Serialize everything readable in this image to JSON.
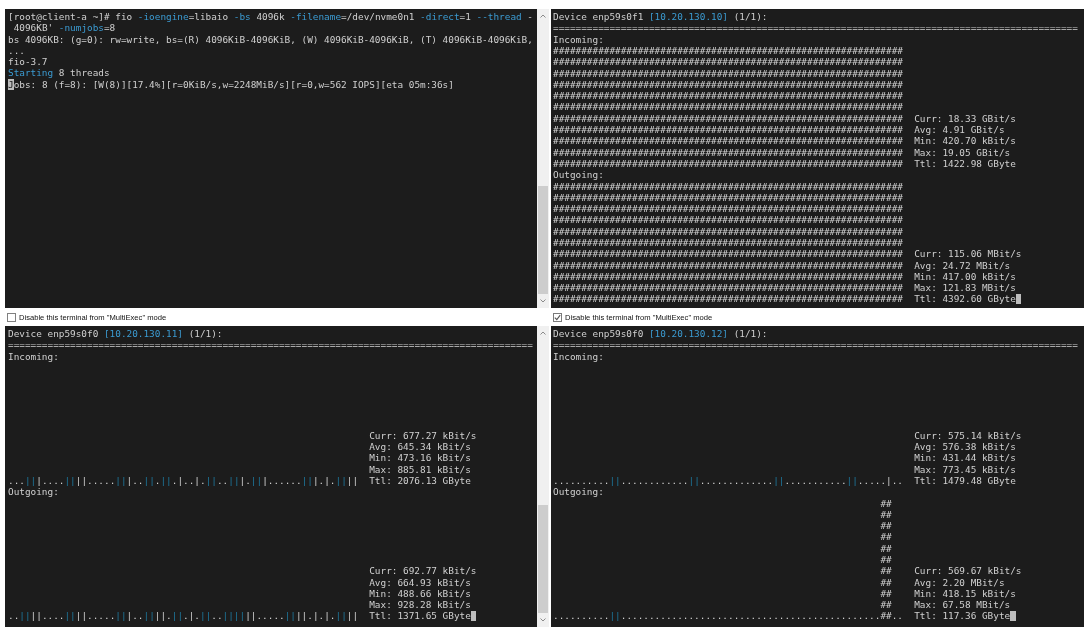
{
  "panes": [
    {
      "kind": "shell",
      "cursor": true,
      "scrollbar": true,
      "lines": [
        [
          {
            "text": "[root@client-a ~]# fio ",
            "kind": "plain"
          },
          {
            "text": "-ioengine",
            "kind": "accent"
          },
          {
            "text": "=libaio ",
            "kind": "plain"
          },
          {
            "text": "-bs",
            "kind": "accent"
          },
          {
            "text": " 4096k ",
            "kind": "plain"
          },
          {
            "text": "-filename",
            "kind": "accent"
          },
          {
            "text": "=/dev/nvme0n1 ",
            "kind": "plain"
          },
          {
            "text": "-direct",
            "kind": "accent"
          },
          {
            "text": "=1 ",
            "kind": "plain"
          },
          {
            "text": "--thread",
            "kind": "accent"
          },
          {
            "text": " -",
            "kind": "plain"
          }
        ],
        [
          {
            "text": " 4096KB' ",
            "kind": "plain"
          },
          {
            "text": "-numjobs",
            "kind": "accent"
          },
          {
            "text": "=8",
            "kind": "plain"
          }
        ],
        [
          {
            "text": "bs 4096KB: (g=0): rw=write, bs=(R) 4096KiB-4096KiB, (W) 4096KiB-4096KiB, (T) 4096KiB-4096KiB,",
            "kind": "plain"
          }
        ],
        [
          {
            "text": "...",
            "kind": "plain"
          }
        ],
        [
          {
            "text": "fio-3.7",
            "kind": "plain"
          }
        ],
        [
          {
            "text": "Starting",
            "kind": "accent"
          },
          {
            "text": " 8 threads",
            "kind": "plain"
          }
        ],
        [
          {
            "text": "Jobs: 8 (f=8): [W(8)][17.4%][r=0KiB/s,w=2248MiB/s][r=0,w=562 IOPS][eta 05m:36s]",
            "kind": "plain"
          }
        ]
      ],
      "multiexec": {
        "label": "Disable this terminal from \"MultiExec\" mode",
        "checked": false
      }
    },
    {
      "kind": "nload",
      "cursor": true,
      "scrollbar": false,
      "header": [
        {
          "text": "Device enp59s0f1 ",
          "kind": "plain"
        },
        {
          "text": "[10.20.130.10]",
          "kind": "accent"
        },
        {
          "text": " (1/1):",
          "kind": "plain"
        }
      ],
      "rule": "=============================================================================================",
      "sections": [
        {
          "label": "Incoming:",
          "rows": [
            [
              {
                "text": "##############################################################",
                "kind": "plain"
              }
            ],
            [
              {
                "text": "##############################################################",
                "kind": "plain"
              }
            ],
            [
              {
                "text": "##############################################################",
                "kind": "plain"
              }
            ],
            [
              {
                "text": "##############################################################",
                "kind": "plain"
              }
            ],
            [
              {
                "text": "##############################################################",
                "kind": "plain"
              }
            ],
            [
              {
                "text": "##############################################################",
                "kind": "plain"
              }
            ],
            [
              {
                "text": "##############################################################",
                "kind": "plain"
              }
            ],
            [
              {
                "text": "##############################################################",
                "kind": "plain"
              }
            ],
            [
              {
                "text": "##############################################################",
                "kind": "plain"
              }
            ],
            [
              {
                "text": "##############################################################",
                "kind": "plain"
              }
            ],
            [
              {
                "text": "##############################################################",
                "kind": "plain"
              }
            ]
          ],
          "stats": [
            "Curr: 18.33 GBit/s",
            "Avg: 4.91 GBit/s",
            "Min: 420.70 kBit/s",
            "Max: 19.05 GBit/s",
            "Ttl: 1422.98 GByte"
          ]
        },
        {
          "label": "Outgoing:",
          "rows": [
            [
              {
                "text": "##############################################################",
                "kind": "plain"
              }
            ],
            [
              {
                "text": "##############################################################",
                "kind": "plain"
              }
            ],
            [
              {
                "text": "##############################################################",
                "kind": "plain"
              }
            ],
            [
              {
                "text": "##############################################################",
                "kind": "plain"
              }
            ],
            [
              {
                "text": "##############################################################",
                "kind": "plain"
              }
            ],
            [
              {
                "text": "##############################################################",
                "kind": "plain"
              }
            ],
            [
              {
                "text": "##############################################################",
                "kind": "plain"
              }
            ],
            [
              {
                "text": "##############################################################",
                "kind": "plain"
              }
            ],
            [
              {
                "text": "##############################################################",
                "kind": "plain"
              }
            ],
            [
              {
                "text": "##############################################################",
                "kind": "plain"
              }
            ],
            [
              {
                "text": "##############################################################",
                "kind": "plain"
              }
            ]
          ],
          "stats": [
            "Curr: 115.06 MBit/s",
            "Avg: 24.72 MBit/s",
            "Min: 417.00 kBit/s",
            "Max: 121.83 MBit/s",
            "Ttl: 4392.60 GByte"
          ]
        }
      ],
      "multiexec": {
        "label": "Disable this terminal from \"MultiExec\" mode",
        "checked": true
      }
    },
    {
      "kind": "nload",
      "cursor": true,
      "scrollbar": true,
      "header": [
        {
          "text": "Device enp59s0f0 ",
          "kind": "plain"
        },
        {
          "text": "[10.20.130.11]",
          "kind": "accent"
        },
        {
          "text": " (1/1):",
          "kind": "plain"
        }
      ],
      "rule": "=============================================================================================",
      "sections": [
        {
          "label": "Incoming:",
          "rows": [
            [
              {
                "text": "...",
                "kind": "plain"
              },
              {
                "text": "||",
                "kind": "bar"
              },
              {
                "text": "|....",
                "kind": "plain"
              },
              {
                "text": "||",
                "kind": "bar"
              },
              {
                "text": "||.....",
                "kind": "plain"
              },
              {
                "text": "||",
                "kind": "bar"
              },
              {
                "text": "|..",
                "kind": "plain"
              },
              {
                "text": "||",
                "kind": "bar"
              },
              {
                "text": ".",
                "kind": "plain"
              },
              {
                "text": "||",
                "kind": "bar"
              },
              {
                "text": ".|..|.",
                "kind": "plain"
              },
              {
                "text": "||",
                "kind": "bar"
              },
              {
                "text": "..",
                "kind": "plain"
              },
              {
                "text": "||",
                "kind": "bar"
              },
              {
                "text": "|.",
                "kind": "plain"
              },
              {
                "text": "||",
                "kind": "bar"
              },
              {
                "text": "|......",
                "kind": "plain"
              },
              {
                "text": "||",
                "kind": "bar"
              },
              {
                "text": "|.|.",
                "kind": "plain"
              },
              {
                "text": "||",
                "kind": "bar"
              },
              {
                "text": "||",
                "kind": "plain"
              }
            ]
          ],
          "stats": [
            "Curr: 677.27 kBit/s",
            "Avg: 645.34 kBit/s",
            "Min: 473.16 kBit/s",
            "Max: 885.81 kBit/s",
            "Ttl: 2076.13 GByte"
          ]
        },
        {
          "label": "Outgoing:",
          "rows": [
            [
              {
                "text": "..",
                "kind": "plain"
              },
              {
                "text": "||",
                "kind": "bar"
              },
              {
                "text": "||....",
                "kind": "plain"
              },
              {
                "text": "||",
                "kind": "bar"
              },
              {
                "text": "||.....",
                "kind": "plain"
              },
              {
                "text": "||",
                "kind": "bar"
              },
              {
                "text": "|..",
                "kind": "plain"
              },
              {
                "text": "||",
                "kind": "bar"
              },
              {
                "text": "||.",
                "kind": "plain"
              },
              {
                "text": "||",
                "kind": "bar"
              },
              {
                "text": ".|.",
                "kind": "plain"
              },
              {
                "text": "||",
                "kind": "bar"
              },
              {
                "text": "..",
                "kind": "plain"
              },
              {
                "text": "||||",
                "kind": "bar"
              },
              {
                "text": "||.....",
                "kind": "plain"
              },
              {
                "text": "||",
                "kind": "bar"
              },
              {
                "text": "||.|.|.",
                "kind": "plain"
              },
              {
                "text": "||",
                "kind": "bar"
              },
              {
                "text": "||",
                "kind": "plain"
              }
            ]
          ],
          "stats": [
            "Curr: 692.77 kBit/s",
            "Avg: 664.93 kBit/s",
            "Min: 488.66 kBit/s",
            "Max: 928.28 kBit/s",
            "Ttl: 1371.65 GByte"
          ]
        }
      ]
    },
    {
      "kind": "nload",
      "cursor": true,
      "scrollbar": false,
      "header": [
        {
          "text": "Device enp59s0f0 ",
          "kind": "plain"
        },
        {
          "text": "[10.20.130.12]",
          "kind": "accent"
        },
        {
          "text": " (1/1):",
          "kind": "plain"
        }
      ],
      "rule": "=============================================================================================",
      "sections": [
        {
          "label": "Incoming:",
          "rows": [
            [
              {
                "text": "..........",
                "kind": "plain"
              },
              {
                "text": "||",
                "kind": "bar"
              },
              {
                "text": "............",
                "kind": "plain"
              },
              {
                "text": "||",
                "kind": "bar"
              },
              {
                "text": ".............",
                "kind": "plain"
              },
              {
                "text": "||",
                "kind": "bar"
              },
              {
                "text": "...........",
                "kind": "plain"
              },
              {
                "text": "||",
                "kind": "bar"
              },
              {
                "text": ".....|..",
                "kind": "plain"
              }
            ]
          ],
          "stats": [
            "Curr: 575.14 kBit/s",
            "Avg: 576.38 kBit/s",
            "Min: 431.44 kBit/s",
            "Max: 773.45 kBit/s",
            "Ttl: 1479.48 GByte"
          ]
        },
        {
          "label": "Outgoing:",
          "rows": [
            [
              {
                "text": "                                                          ##",
                "kind": "plain"
              }
            ],
            [
              {
                "text": "                                                          ##",
                "kind": "plain"
              }
            ],
            [
              {
                "text": "                                                          ##",
                "kind": "plain"
              }
            ],
            [
              {
                "text": "                                                          ##",
                "kind": "plain"
              }
            ],
            [
              {
                "text": "                                                          ##",
                "kind": "plain"
              }
            ],
            [
              {
                "text": "                                                          ##",
                "kind": "plain"
              }
            ],
            [
              {
                "text": "                                                          ##",
                "kind": "plain"
              }
            ],
            [
              {
                "text": "                                                          ##",
                "kind": "plain"
              }
            ],
            [
              {
                "text": "                                                          ##",
                "kind": "plain"
              }
            ],
            [
              {
                "text": "                                                          ##",
                "kind": "plain"
              }
            ],
            [
              {
                "text": "..........",
                "kind": "plain"
              },
              {
                "text": "||",
                "kind": "bar"
              },
              {
                "text": "..............................................##..",
                "kind": "plain"
              }
            ]
          ],
          "stats": [
            "Curr: 569.67 kBit/s",
            "Avg: 2.20 MBit/s",
            "Min: 418.15 kBit/s",
            "Max: 67.58 MBit/s",
            "Ttl: 117.36 GByte"
          ]
        }
      ]
    }
  ]
}
